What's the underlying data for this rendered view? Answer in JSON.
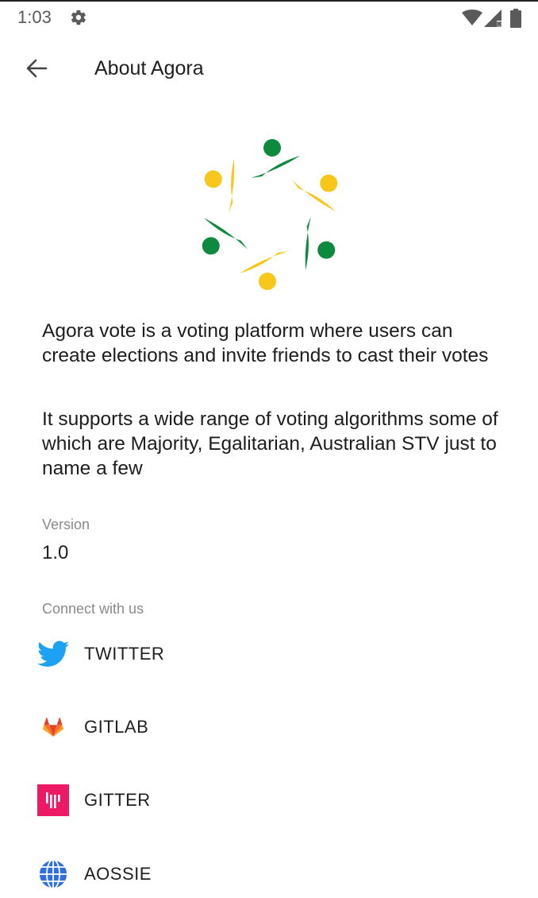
{
  "status_bar": {
    "time": "1:03",
    "icons": [
      "gear-icon",
      "wifi-icon",
      "signal-icon",
      "battery-icon"
    ]
  },
  "toolbar": {
    "title": "About Agora",
    "back_icon": "arrow-left-icon"
  },
  "logo": {
    "icon": "agora-logo",
    "colors": {
      "green": "#0E8A3E",
      "yellow": "#F7C71C"
    }
  },
  "about": {
    "paragraph_1": "Agora vote is a voting platform where users can create elections and invite friends to cast their votes",
    "paragraph_2": "It supports a wide range of voting algorithms some of which are Majority, Egalitarian, Australian STV just to name a few"
  },
  "version": {
    "label": "Version",
    "value": "1.0"
  },
  "connect": {
    "label": "Connect with us",
    "items": [
      {
        "label": "TWITTER",
        "icon": "twitter-icon",
        "color": "#1DA1F2"
      },
      {
        "label": "GITLAB",
        "icon": "gitlab-icon",
        "color": "#E24329"
      },
      {
        "label": "GITTER",
        "icon": "gitter-icon",
        "color": "#ED1965"
      },
      {
        "label": "AOSSIE",
        "icon": "globe-icon",
        "color": "#2F6FE0"
      }
    ]
  }
}
